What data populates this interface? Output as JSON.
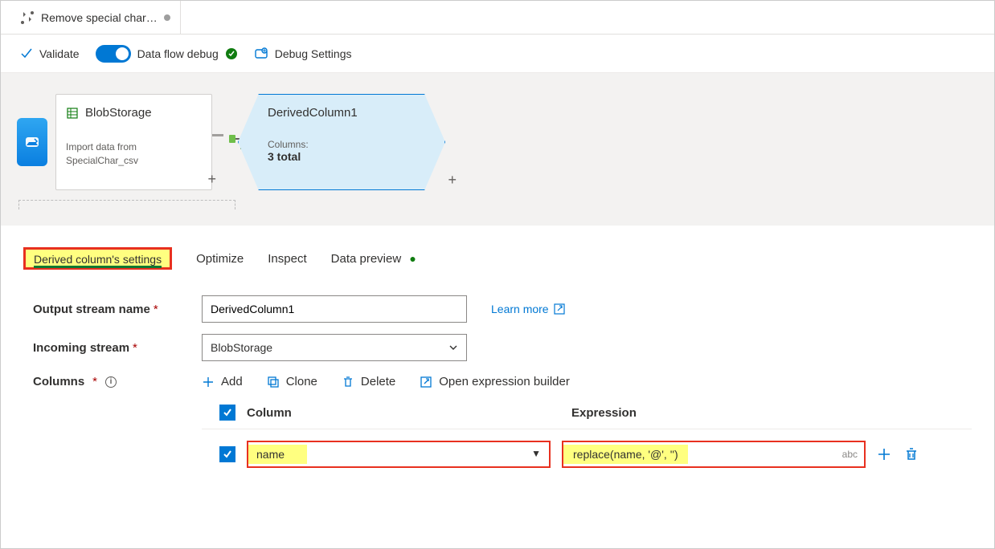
{
  "header": {
    "title": "Remove special char…"
  },
  "toolbar": {
    "validate": "Validate",
    "debug_toggle": "Data flow debug",
    "debug_settings": "Debug Settings"
  },
  "canvas": {
    "source": {
      "title": "BlobStorage",
      "description": "Import data from SpecialChar_csv"
    },
    "derived": {
      "title": "DerivedColumn1",
      "sub_label": "Columns:",
      "count_text": "3 total"
    }
  },
  "panel": {
    "tabs": [
      "Derived column's settings",
      "Optimize",
      "Inspect",
      "Data preview"
    ],
    "output_stream_label": "Output stream name",
    "output_stream_value": "DerivedColumn1",
    "learn_more": "Learn more",
    "incoming_stream_label": "Incoming stream",
    "incoming_stream_value": "BlobStorage",
    "columns_label": "Columns",
    "actions": {
      "add": "Add",
      "clone": "Clone",
      "delete": "Delete",
      "open_builder": "Open expression builder"
    },
    "table": {
      "headers": [
        "Column",
        "Expression"
      ],
      "rows": [
        {
          "column": "name",
          "expression": "replace(name, '@', '')",
          "type_hint": "abc"
        }
      ]
    }
  },
  "colors": {
    "accent": "#0078d4",
    "highlight_bg": "#ffff80",
    "highlight_border": "#e8301f",
    "success": "#107c10"
  }
}
